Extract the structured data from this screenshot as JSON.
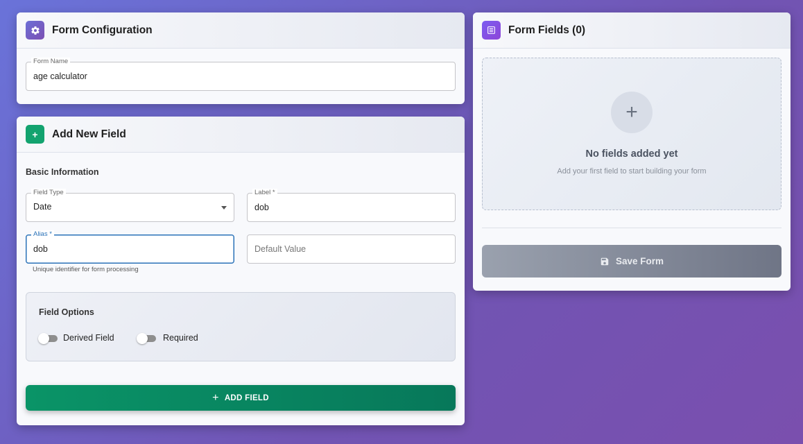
{
  "config": {
    "title": "Form Configuration",
    "form_name": {
      "label": "Form Name",
      "value": "age calculator"
    }
  },
  "add_field": {
    "title": "Add New Field",
    "section_basic": "Basic Information",
    "field_type": {
      "label": "Field Type",
      "value": "Date"
    },
    "label_field": {
      "label": "Label *",
      "value": "dob"
    },
    "alias_field": {
      "label": "Alias *",
      "value": "dob",
      "helper": "Unique identifier for form processing"
    },
    "default_value": {
      "placeholder": "Default Value"
    },
    "options": {
      "title": "Field Options",
      "derived": {
        "label": "Derived Field",
        "checked": false
      },
      "required": {
        "label": "Required",
        "checked": false
      }
    },
    "add_button": "ADD FIELD"
  },
  "fields_panel": {
    "title": "Form Fields (0)",
    "empty_title": "No fields added yet",
    "empty_sub": "Add your first field to start building your form",
    "save_button": "Save Form"
  },
  "icons": {
    "config": "gear-icon",
    "add": "plus-icon",
    "fields": "list-icon",
    "empty": "plus-icon",
    "save": "floppy-disk-icon"
  },
  "colors": {
    "accent_green": "#0a9467",
    "accent_purple": "#7154b3",
    "focus_blue": "#2a72b8",
    "save_disabled": "#8a90a0"
  }
}
